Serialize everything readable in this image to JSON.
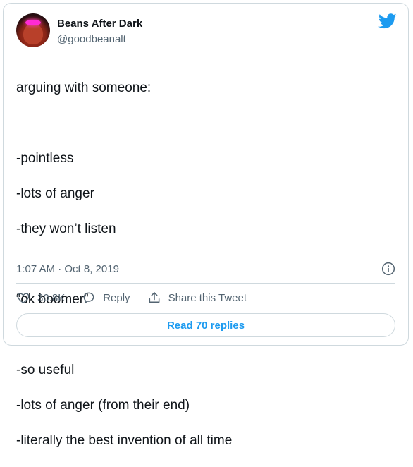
{
  "author": {
    "name": "Beans After Dark",
    "handle": "@goodbeanalt"
  },
  "tweet": {
    "lines": [
      "arguing with someone:",
      "",
      "-pointless",
      "-lots of anger",
      "-they won’t listen",
      "",
      "“ok boomer”",
      "",
      "-so useful",
      "-lots of anger (from their end)",
      "-literally the best invention of all time"
    ],
    "timestamp": "1:07 AM · Oct 8, 2019"
  },
  "actions": {
    "like_count": "30.8K",
    "reply_label": "Reply",
    "share_label": "Share this Tweet"
  },
  "replies_button": {
    "label": "Read 70 replies"
  },
  "colors": {
    "brand": "#1d9bf0",
    "text": "#0f1419",
    "secondary_text": "#536471",
    "border": "#cfd9de"
  },
  "icons": [
    "twitter-bird-icon",
    "info-icon",
    "heart-icon",
    "reply-bubble-icon",
    "share-icon"
  ]
}
